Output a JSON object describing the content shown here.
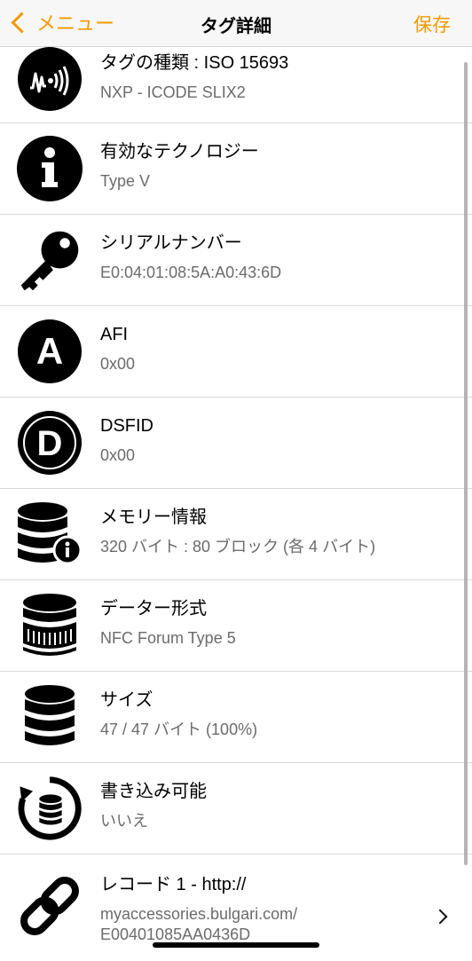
{
  "nav": {
    "back_label": "メニュー",
    "title": "タグ詳細",
    "save_label": "保存"
  },
  "colors": {
    "accent": "#f29a00",
    "secondary_text": "#6b6b6b",
    "separator": "#d9d9d9"
  },
  "rows": [
    {
      "icon": "nfc-sound-icon",
      "title": "タグの種類 : ISO 15693",
      "sub": "NXP - ICODE SLIX2"
    },
    {
      "icon": "info-icon",
      "title": "有効なテクノロジー",
      "sub": "Type V"
    },
    {
      "icon": "key-icon",
      "title": "シリアルナンバー",
      "sub": "E0:04:01:08:5A:A0:43:6D"
    },
    {
      "icon": "letter-a-icon",
      "title": "AFI",
      "sub": "0x00"
    },
    {
      "icon": "letter-d-icon",
      "title": "DSFID",
      "sub": "0x00"
    },
    {
      "icon": "database-info-icon",
      "title": "メモリー情報",
      "sub": "320 バイト : 80 ブロック (各 4 バイト)"
    },
    {
      "icon": "database-format-icon",
      "title": "データー形式",
      "sub": "NFC Forum Type 5"
    },
    {
      "icon": "database-icon",
      "title": "サイズ",
      "sub": "47 / 47 バイト (100%)"
    },
    {
      "icon": "database-refresh-icon",
      "title": "書き込み可能",
      "sub": "いいえ"
    },
    {
      "icon": "link-icon",
      "title": "レコード 1 - http://",
      "sub": "myaccessories.bulgari.com/",
      "sub2": "E00401085AA0436D"
    }
  ]
}
